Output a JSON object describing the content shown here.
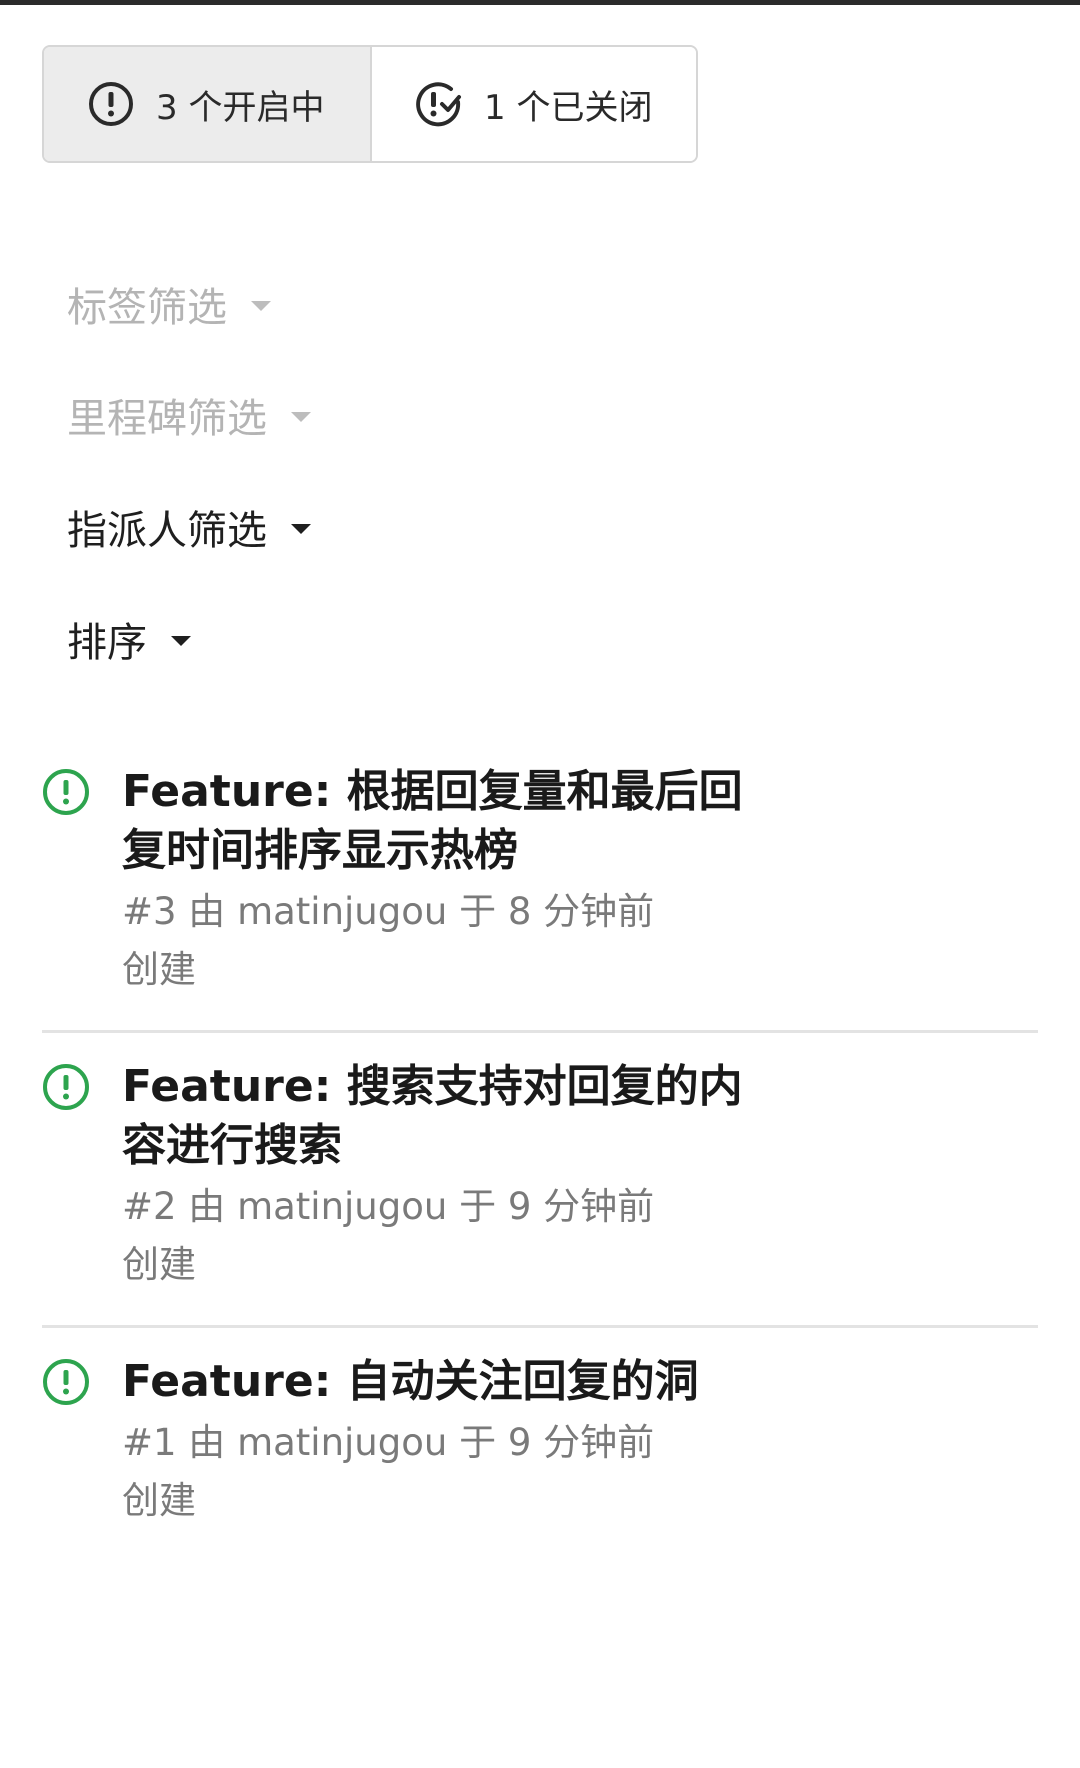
{
  "state_tabs": {
    "open_label": "3 个开启中",
    "closed_label": "1 个已关闭"
  },
  "filters": {
    "label": "标签筛选",
    "milestone": "里程碑筛选",
    "assignee": "指派人筛选",
    "sort": "排序"
  },
  "colors": {
    "open_icon": "#2da44e"
  },
  "issues": [
    {
      "title": "Feature: 根据回复量和最后回复时间排序显示热榜",
      "meta": "#3 由 matinjugou 于 8 分钟前创建",
      "icon": "issue-open-icon"
    },
    {
      "title": "Feature: 搜索支持对回复的内容进行搜索",
      "meta": "#2 由 matinjugou 于 9 分钟前创建",
      "icon": "issue-open-icon"
    },
    {
      "title": "Feature: 自动关注回复的洞",
      "meta": "#1 由 matinjugou 于 9 分钟前创建",
      "icon": "issue-open-icon"
    }
  ]
}
